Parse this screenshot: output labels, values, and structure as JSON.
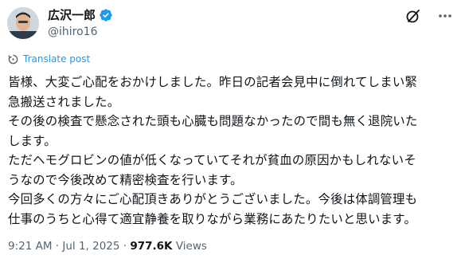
{
  "author": {
    "display_name": "広沢一郎",
    "handle": "@ihiro16",
    "verified_color": "#1d9bf0",
    "avatar_icon": "avatar"
  },
  "actions": {
    "grok_icon": "grok-icon",
    "more_icon": "more-icon"
  },
  "translate": {
    "label": "Translate post",
    "icon": "translate-icon",
    "color": "#1d9bf0"
  },
  "tweet": {
    "lines": [
      "皆様、大変ご心配をおかけしました。昨日の記者会見中に倒れてしまい緊",
      "急搬送されました。",
      "その後の検査で懸念された頭も心臓も問題なかったので間も無く退院いた",
      "します。",
      "ただヘモグロビンの値が低くなっていてそれが貧血の原因かもしれないそ",
      "うなので今後改めて精密検査を行います。",
      "今回多くの方々にご心配頂きありがとうございました。今後は体調管理も",
      "仕事のうちと心得て適宜静養を取りながら業務にあたりたいと思います。"
    ]
  },
  "meta": {
    "time": "9:21 AM",
    "sep1": " · ",
    "date": "Jul 1, 2025",
    "sep2": " · ",
    "views_count": "977.6K",
    "views_label": " Views"
  }
}
